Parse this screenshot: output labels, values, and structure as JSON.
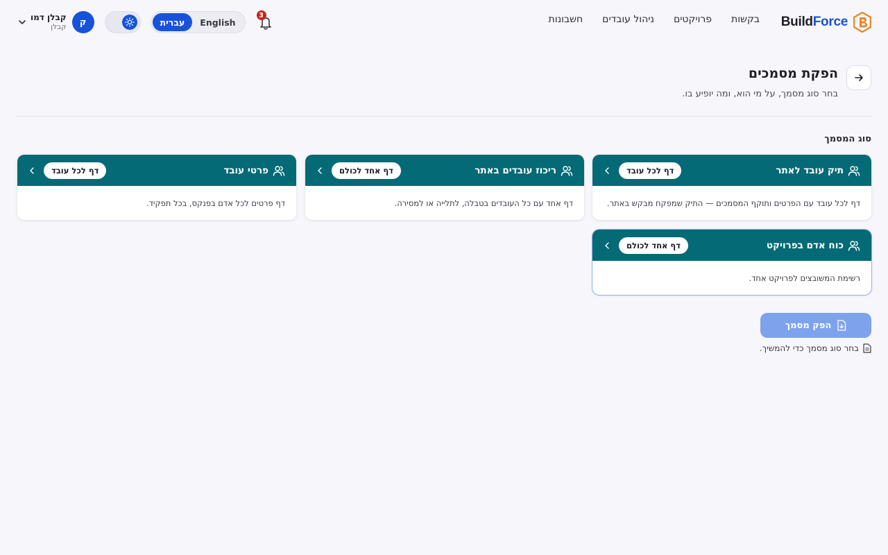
{
  "app": {
    "brand_part1": "Build",
    "brand_part2": "Force"
  },
  "nav": {
    "items": [
      {
        "label": "בקשות"
      },
      {
        "label": "פרויקטים"
      },
      {
        "label": "ניהול עובדים"
      },
      {
        "label": "חשבונות"
      }
    ]
  },
  "notifications": {
    "count": "3"
  },
  "language": {
    "english": "English",
    "hebrew": "עברית",
    "active": "hebrew"
  },
  "user": {
    "name": "קבלן דמו",
    "role": "קבלן",
    "initial": "ק"
  },
  "page": {
    "title": "הפקת מסמכים",
    "subtitle": "בחר סוג מסמך, על מי הוא, ומה יופיע בו."
  },
  "section": {
    "label": "סוג המסמך"
  },
  "cards": [
    {
      "title": "תיק עובד לאתר",
      "pill": "דף לכל עובד",
      "desc": "דף לכל עובד עם הפרטים ותוקף המסמכים — התיק שמפקח מבקש באתר."
    },
    {
      "title": "ריכוז עובדים באתר",
      "pill": "דף אחד לכולם",
      "desc": "דף אחד עם כל העובדים בטבלה, לתלייה או למסירה."
    },
    {
      "title": "פרטי עובד",
      "pill": "דף לכל עובד",
      "desc": "דף פרטים לכל אדם בפנקס, בכל תפקיד."
    },
    {
      "title": "כוח אדם בפרויקט",
      "pill": "דף אחד לכולם",
      "desc": "רשימת המשובצים לפרויקט אחד."
    }
  ],
  "actions": {
    "produce_label": "הפק מסמך",
    "hint": "בחר סוג מסמך כדי להמשיך."
  },
  "colors": {
    "card_header": "#046a75",
    "primary": "#1653d9",
    "primary_disabled": "#7ea2ec",
    "badge": "#c9241c",
    "logo_orange": "#e8872a"
  }
}
